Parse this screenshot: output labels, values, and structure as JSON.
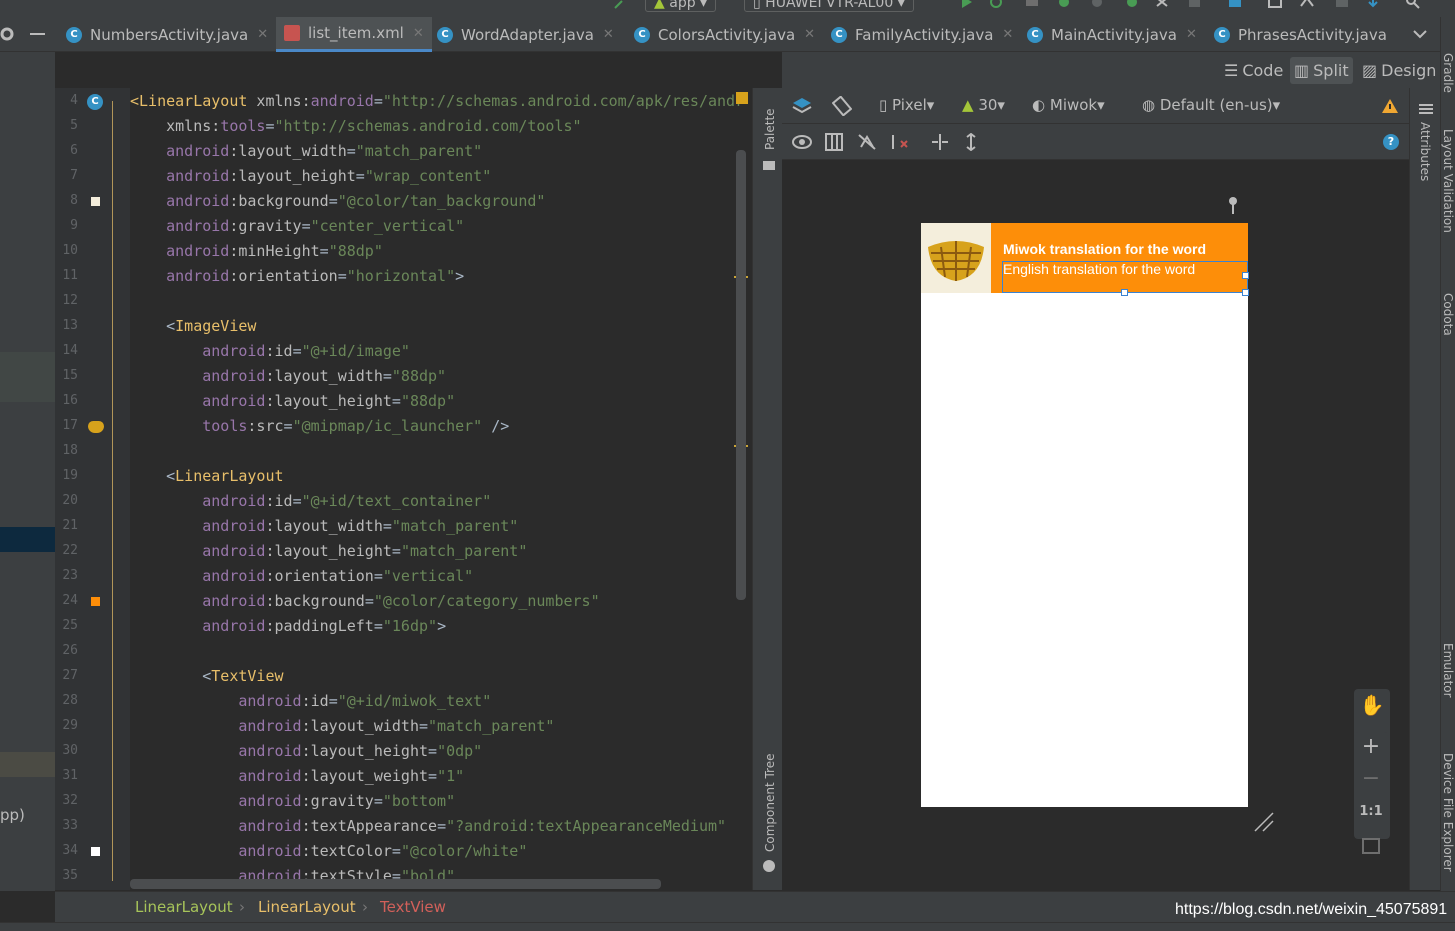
{
  "toolbar": {
    "run_config": "app",
    "device": "HUAWEI VTR-AL00"
  },
  "tabs": [
    {
      "label": "NumbersActivity.java",
      "type": "java"
    },
    {
      "label": "list_item.xml",
      "type": "xml",
      "active": true
    },
    {
      "label": "WordAdapter.java",
      "type": "java"
    },
    {
      "label": "ColorsActivity.java",
      "type": "java"
    },
    {
      "label": "FamilyActivity.java",
      "type": "java"
    },
    {
      "label": "MainActivity.java",
      "type": "java"
    },
    {
      "label": "PhrasesActivity.java",
      "type": "java"
    }
  ],
  "left_panel": {
    "partial_text": "pp)"
  },
  "view_modes": {
    "code": "Code",
    "split": "Split",
    "design": "Design",
    "active": "Split"
  },
  "editor": {
    "lines": [
      {
        "n": "4",
        "tokens": [
          [
            "tag",
            "<LinearLayout"
          ],
          [
            "attr",
            " xmlns:"
          ],
          [
            "ns",
            "android"
          ],
          [
            "pun",
            "="
          ],
          [
            "val",
            "\"http://schemas.android.com/apk/res/andr"
          ]
        ]
      },
      {
        "n": "5",
        "tokens": [
          [
            "attr",
            "    xmlns:"
          ],
          [
            "ns",
            "tools"
          ],
          [
            "pun",
            "="
          ],
          [
            "val",
            "\"http://schemas.android.com/tools\""
          ]
        ]
      },
      {
        "n": "6",
        "tokens": [
          [
            "ns",
            "    android"
          ],
          [
            "attr",
            ":layout_width"
          ],
          [
            "pun",
            "="
          ],
          [
            "val",
            "\"match_parent\""
          ]
        ]
      },
      {
        "n": "7",
        "tokens": [
          [
            "ns",
            "    android"
          ],
          [
            "attr",
            ":layout_height"
          ],
          [
            "pun",
            "="
          ],
          [
            "val",
            "\"wrap_content\""
          ]
        ]
      },
      {
        "n": "8",
        "tokens": [
          [
            "ns",
            "    android"
          ],
          [
            "attr",
            ":background"
          ],
          [
            "pun",
            "="
          ],
          [
            "val",
            "\"@color/tan_background\""
          ]
        ]
      },
      {
        "n": "9",
        "tokens": [
          [
            "ns",
            "    android"
          ],
          [
            "attr",
            ":gravity"
          ],
          [
            "pun",
            "="
          ],
          [
            "val",
            "\"center_vertical\""
          ]
        ]
      },
      {
        "n": "10",
        "tokens": [
          [
            "ns",
            "    android"
          ],
          [
            "attr",
            ":minHeight"
          ],
          [
            "pun",
            "="
          ],
          [
            "val",
            "\"88dp\""
          ]
        ]
      },
      {
        "n": "11",
        "tokens": [
          [
            "ns",
            "    android"
          ],
          [
            "attr",
            ":orientation"
          ],
          [
            "pun",
            "="
          ],
          [
            "val",
            "\"horizontal\""
          ],
          [
            "pun",
            ">"
          ]
        ]
      },
      {
        "n": "12",
        "tokens": []
      },
      {
        "n": "13",
        "tokens": [
          [
            "pun",
            "    <"
          ],
          [
            "tag",
            "ImageView"
          ]
        ]
      },
      {
        "n": "14",
        "tokens": [
          [
            "ns",
            "        android"
          ],
          [
            "attr",
            ":id"
          ],
          [
            "pun",
            "="
          ],
          [
            "val",
            "\"@+id/image\""
          ]
        ]
      },
      {
        "n": "15",
        "tokens": [
          [
            "ns",
            "        android"
          ],
          [
            "attr",
            ":layout_width"
          ],
          [
            "pun",
            "="
          ],
          [
            "val",
            "\"88dp\""
          ]
        ]
      },
      {
        "n": "16",
        "tokens": [
          [
            "ns",
            "        android"
          ],
          [
            "attr",
            ":layout_height"
          ],
          [
            "pun",
            "="
          ],
          [
            "val",
            "\"88dp\""
          ]
        ]
      },
      {
        "n": "17",
        "tokens": [
          [
            "ns",
            "        tools"
          ],
          [
            "attr",
            ":src"
          ],
          [
            "pun",
            "="
          ],
          [
            "val",
            "\"@mipmap/ic_launcher\""
          ],
          [
            "pun",
            " />"
          ]
        ]
      },
      {
        "n": "18",
        "tokens": []
      },
      {
        "n": "19",
        "tokens": [
          [
            "pun",
            "    <"
          ],
          [
            "tag",
            "LinearLayout"
          ]
        ]
      },
      {
        "n": "20",
        "tokens": [
          [
            "ns",
            "        android"
          ],
          [
            "attr",
            ":id"
          ],
          [
            "pun",
            "="
          ],
          [
            "val",
            "\"@+id/text_container\""
          ]
        ]
      },
      {
        "n": "21",
        "tokens": [
          [
            "ns",
            "        android"
          ],
          [
            "attr",
            ":layout_width"
          ],
          [
            "pun",
            "="
          ],
          [
            "val",
            "\"match_parent\""
          ]
        ]
      },
      {
        "n": "22",
        "tokens": [
          [
            "ns",
            "        android"
          ],
          [
            "attr",
            ":layout_height"
          ],
          [
            "pun",
            "="
          ],
          [
            "val",
            "\"match_parent\""
          ]
        ]
      },
      {
        "n": "23",
        "tokens": [
          [
            "ns",
            "        android"
          ],
          [
            "attr",
            ":orientation"
          ],
          [
            "pun",
            "="
          ],
          [
            "val",
            "\"vertical\""
          ]
        ]
      },
      {
        "n": "24",
        "tokens": [
          [
            "ns",
            "        android"
          ],
          [
            "attr",
            ":background"
          ],
          [
            "pun",
            "="
          ],
          [
            "val",
            "\"@color/category_numbers\""
          ]
        ]
      },
      {
        "n": "25",
        "tokens": [
          [
            "ns",
            "        android"
          ],
          [
            "attr",
            ":paddingLeft"
          ],
          [
            "pun",
            "="
          ],
          [
            "val",
            "\"16dp\""
          ],
          [
            "pun",
            ">"
          ]
        ]
      },
      {
        "n": "26",
        "tokens": []
      },
      {
        "n": "27",
        "tokens": [
          [
            "pun",
            "        <"
          ],
          [
            "tag",
            "TextView"
          ]
        ]
      },
      {
        "n": "28",
        "tokens": [
          [
            "ns",
            "            android"
          ],
          [
            "attr",
            ":id"
          ],
          [
            "pun",
            "="
          ],
          [
            "val",
            "\"@+id/miwok_text\""
          ]
        ]
      },
      {
        "n": "29",
        "tokens": [
          [
            "ns",
            "            android"
          ],
          [
            "attr",
            ":layout_width"
          ],
          [
            "pun",
            "="
          ],
          [
            "val",
            "\"match_parent\""
          ]
        ]
      },
      {
        "n": "30",
        "tokens": [
          [
            "ns",
            "            android"
          ],
          [
            "attr",
            ":layout_height"
          ],
          [
            "pun",
            "="
          ],
          [
            "val",
            "\"0dp\""
          ]
        ]
      },
      {
        "n": "31",
        "tokens": [
          [
            "ns",
            "            android"
          ],
          [
            "attr",
            ":layout_weight"
          ],
          [
            "pun",
            "="
          ],
          [
            "val",
            "\"1\""
          ]
        ]
      },
      {
        "n": "32",
        "tokens": [
          [
            "ns",
            "            android"
          ],
          [
            "attr",
            ":gravity"
          ],
          [
            "pun",
            "="
          ],
          [
            "val",
            "\"bottom\""
          ]
        ]
      },
      {
        "n": "33",
        "tokens": [
          [
            "ns",
            "            android"
          ],
          [
            "attr",
            ":textAppearance"
          ],
          [
            "pun",
            "="
          ],
          [
            "val",
            "\"?android:textAppearanceMedium\""
          ]
        ]
      },
      {
        "n": "34",
        "tokens": [
          [
            "ns",
            "            android"
          ],
          [
            "attr",
            ":textColor"
          ],
          [
            "pun",
            "="
          ],
          [
            "val",
            "\"@color/white\""
          ]
        ]
      },
      {
        "n": "35",
        "tokens": [
          [
            "ns",
            "            android"
          ],
          [
            "attr",
            ":textStyle"
          ],
          [
            "pun",
            "="
          ],
          [
            "val",
            "\"bold\""
          ]
        ]
      }
    ]
  },
  "side_panels": {
    "palette": "Palette",
    "component_tree": "Component Tree",
    "attributes": "Attributes",
    "gradle": "Gradle",
    "layout_validation": "Layout Validation",
    "codota": "Codota",
    "emulator": "Emulator",
    "device_file_explorer": "Device File Explorer"
  },
  "design_toolbar": {
    "device": "Pixel",
    "api": "30",
    "theme": "Miwok",
    "locale": "Default (en-us)"
  },
  "preview": {
    "miwok_text": "Miwok translation for the word",
    "english_text": "English translation for the word",
    "text_bg_color": "#fd8e09",
    "row_bg_color": "#f4eedc"
  },
  "zoom": {
    "plus": "+",
    "minus": "−",
    "one_to_one": "1:1"
  },
  "breadcrumb": [
    "LinearLayout",
    "LinearLayout",
    "TextView"
  ],
  "watermark": "https://blog.csdn.net/weixin_45075891"
}
